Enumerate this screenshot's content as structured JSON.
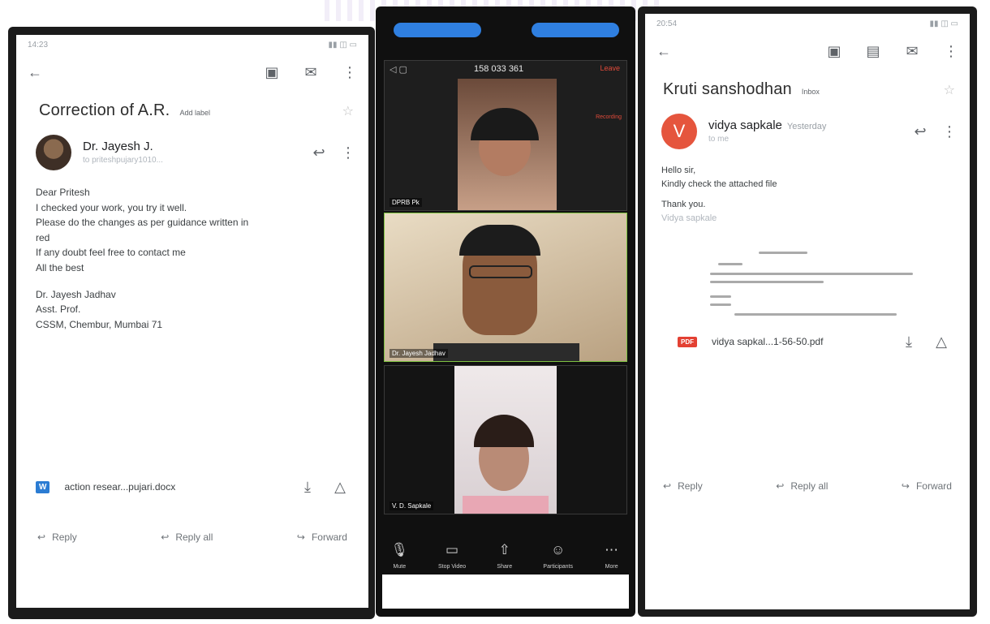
{
  "left_email": {
    "status": {
      "time": "14:23",
      "battery": ""
    },
    "subject": "Correction of A.R.",
    "label_chip": "Add label",
    "sender_name": "Dr. Jayesh J.",
    "recipient": "to priteshpujary1010...",
    "body": "Dear Pritesh\nI checked your work, you try it well.\nPlease do the changes as per guidance written in\nred\nIf any doubt feel free to contact me\nAll the best",
    "signature": "Dr. Jayesh Jadhav\nAsst. Prof.\nCSSM, Chembur, Mumbai 71",
    "attachment": {
      "type": "W",
      "name": "action resear...pujari.docx"
    },
    "actions": {
      "reply": "Reply",
      "reply_all": "Reply all",
      "forward": "Forward"
    }
  },
  "zoom": {
    "meeting_id": "158 033 361",
    "tiles": [
      {
        "name": "DPRB Pk"
      },
      {
        "name": "Dr. Jayesh Jadhav"
      },
      {
        "name": "V. D. Sapkale"
      }
    ],
    "controls": [
      {
        "label": "Mute",
        "icon": "microphone-icon"
      },
      {
        "label": "Stop Video",
        "icon": "video-camera-icon"
      },
      {
        "label": "Share",
        "icon": "share-icon"
      },
      {
        "label": "Participants",
        "icon": "participants-icon"
      },
      {
        "label": "More",
        "icon": "more-icon"
      }
    ],
    "leave_label": "Leave",
    "recording_label": "Recording"
  },
  "right_email": {
    "status": {
      "time": "20:54",
      "battery": ""
    },
    "subject": "Kruti sanshodhan",
    "label_chip": "Inbox",
    "sender_name": "vidya sapkale",
    "date": "Yesterday",
    "recipient": "to me",
    "body": "Hello sir,\nKindly check the attached file",
    "thanks": "Thank you.",
    "signature": "Vidya sapkale",
    "attachment": {
      "type": "PDF",
      "name": "vidya sapkal...1-56-50.pdf"
    },
    "actions": {
      "reply": "Reply",
      "reply_all": "Reply all",
      "forward": "Forward"
    }
  }
}
